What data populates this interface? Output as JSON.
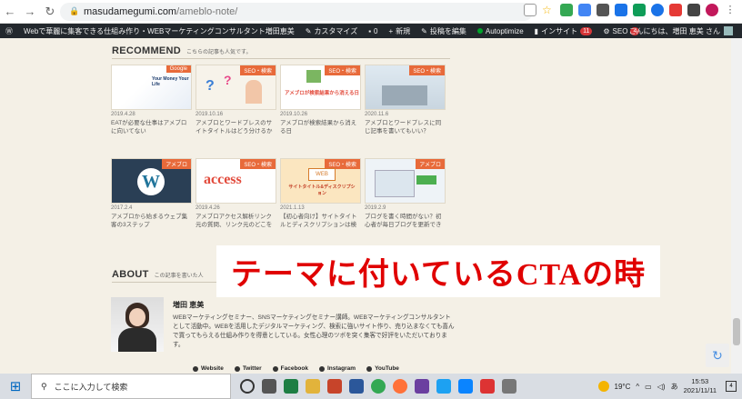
{
  "browser": {
    "url_domain": "masudamegumi.com",
    "url_path": "/ameblo-note/"
  },
  "wp_admin_bar": {
    "site_title": "Webで華麗に集客できる仕組み作り・WEBマーケティングコンサルタント増田恵美",
    "customize": "カスタマイズ",
    "comments": "0",
    "new": "新規",
    "edit": "投稿を編集",
    "autoptimize": "Autoptimize",
    "insight": "インサイト",
    "insight_badge": "11",
    "seo": "SEO",
    "seo_badge": "4",
    "greeting": "こんにちは、増田 恵美 さん"
  },
  "recommend": {
    "title": "RECOMMEND",
    "subtitle": "こちらの記事も人気です。",
    "cards": [
      {
        "category": "Google",
        "date": "2019.4.28",
        "title": "EATが必要な仕事はアメブロに向いてない",
        "thumb": "Your Money Your Life"
      },
      {
        "category": "SEO・検索",
        "date": "2019.10.16",
        "title": "アメブロとワードプレスのサイトタイトルはどう分けるか",
        "thumb": ""
      },
      {
        "category": "SEO・検索",
        "date": "2019.10.26",
        "title": "アメブロが検索結果から消える日",
        "thumb": "アメブロが検索結果から消える日"
      },
      {
        "category": "SEO・検索",
        "date": "2020.11.6",
        "title": "アメブロとワードプレスに同じ記事を書いてもいい？",
        "thumb": ""
      },
      {
        "category": "アメブロ",
        "date": "2017.2.4",
        "title": "アメブロから始まるウェブ集客の3ステップ",
        "thumb": ""
      },
      {
        "category": "SEO・検索",
        "date": "2019.4.26",
        "title": "アメブロアクセス解析リンク元の質問、リンク元のどこを伸ばす？",
        "thumb": "access"
      },
      {
        "category": "SEO・検索",
        "date": "2021.1.13",
        "title": "【初心者向け】サイトタイトルとディスクリプションは検索エンジン用と人の目…",
        "thumb": "サイトタイトル&ディスクリプション"
      },
      {
        "category": "アメブロ",
        "date": "2019.2.9",
        "title": "ブログを書く時間がない？初心者が毎日ブログを更新できない本当の理由とは",
        "thumb": ""
      }
    ]
  },
  "cta_overlay": "テーマに付いているCTAの時",
  "about": {
    "title": "ABOUT",
    "subtitle": "この記事を書いた人",
    "name": "増田 恵美",
    "bio": "WEBマーケティングセミナー、SNSマーケティングセミナー講師。WEBマーケティングコンサルタントとして活動中。WEBを活用したデジタルマーケティング、検索に強いサイト作り、売り込まなくても喜んで買ってもらえる仕組み作りを得意としている。女性心理のツボを突く集客で好評をいただいております。"
  },
  "social": [
    "Website",
    "Twitter",
    "Facebook",
    "Instagram",
    "YouTube"
  ],
  "taskbar": {
    "search_placeholder": "ここに入力して検索",
    "weather": "19°C",
    "ime": "あ",
    "time": "15:53",
    "date": "2021/11/11",
    "notif_count": "4"
  },
  "colors": {
    "accent": "#e86a3a",
    "cta": "#e00000",
    "wpbar": "#23282d"
  }
}
